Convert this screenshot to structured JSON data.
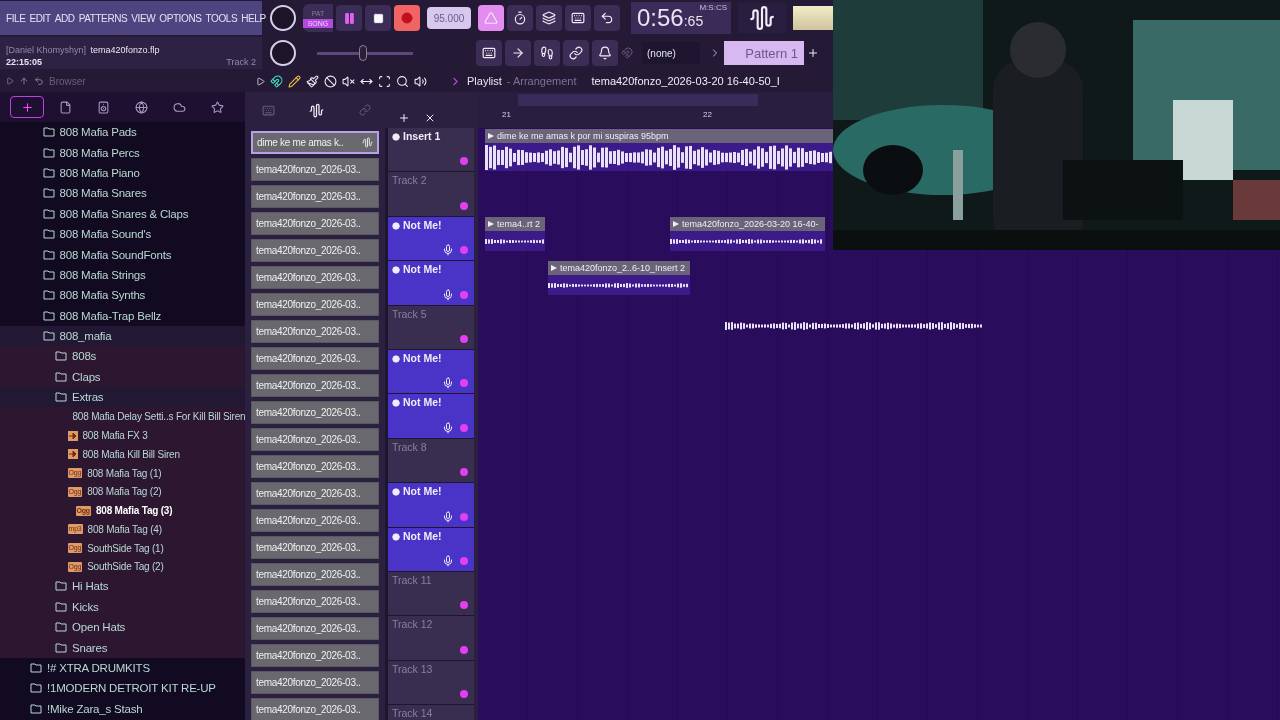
{
  "menu": [
    "FILE",
    "EDIT",
    "ADD",
    "PATTERNS",
    "VIEW",
    "OPTIONS",
    "TOOLS",
    "HELP"
  ],
  "transport": {
    "modes": [
      {
        "label": "PAT",
        "selected": false
      },
      {
        "label": "SONG",
        "selected": true
      }
    ],
    "playing": true,
    "tempo": "95.000",
    "time": "0:56",
    "time_fraction": ":65",
    "time_format": "M:S:CS"
  },
  "project": {
    "user": "[Daniel Khomyshyn]",
    "file": "tema420fonzo.flp",
    "clock": "22:15:05",
    "hint": "Track 2"
  },
  "master_pitch": {
    "level": 0.48
  },
  "snap": "(none)",
  "pattern": "Pattern 1",
  "browser": {
    "title": "Browser",
    "tabs": [
      {
        "kind": "all",
        "selected": true
      },
      {
        "kind": "file",
        "selected": false
      },
      {
        "kind": "speaker",
        "selected": false
      },
      {
        "kind": "plugin",
        "selected": false
      },
      {
        "kind": "cloud",
        "selected": false
      },
      {
        "kind": "star",
        "selected": false
      }
    ],
    "branch": [
      {
        "kind": "folder",
        "label": "808 Mafia Pads",
        "expanded": false,
        "selected": false
      },
      {
        "kind": "folder",
        "label": "808 Mafia Percs",
        "expanded": false,
        "selected": false
      },
      {
        "kind": "folder",
        "label": "808 Mafia Piano",
        "expanded": false,
        "selected": false
      },
      {
        "kind": "folder",
        "label": "808 Mafia Snares",
        "expanded": false,
        "selected": false
      },
      {
        "kind": "folder",
        "label": "808 Mafia Snares & Claps",
        "expanded": false,
        "selected": false
      },
      {
        "kind": "folder",
        "label": "808 Mafia Sound's",
        "expanded": false,
        "selected": false
      },
      {
        "kind": "folder",
        "label": "808 Mafia SoundFonts",
        "expanded": false,
        "selected": false
      },
      {
        "kind": "folder",
        "label": "808 Mafia Strings",
        "expanded": false,
        "selected": false
      },
      {
        "kind": "folder",
        "label": "808 Mafia Synths",
        "expanded": false,
        "selected": false
      },
      {
        "kind": "folder",
        "label": "808 Mafia-Trap Bellz",
        "expanded": false,
        "selected": false
      },
      {
        "kind": "folder",
        "label": "808_mafia",
        "expanded": true,
        "selected": false,
        "children": [
          {
            "kind": "folder",
            "label": "808s",
            "expanded": false,
            "selected": false
          },
          {
            "kind": "folder",
            "label": "Claps",
            "expanded": false,
            "selected": false
          },
          {
            "kind": "folder",
            "label": "Extras",
            "expanded": true,
            "selected": false,
            "children": [
              {
                "kind": "preset",
                "label": "808 Mafia Delay Setti..s For Kill Bill Siren",
                "selected": false
              },
              {
                "kind": "audio",
                "label": "808 Mafia FX 3",
                "selected": false
              },
              {
                "kind": "audio",
                "label": "808 Mafia Kill Bill Siren",
                "selected": false
              },
              {
                "kind": "badge",
                "badge": "Ogg",
                "label": "808 Mafia Tag (1)",
                "selected": false
              },
              {
                "kind": "badge",
                "badge": "Ogg",
                "label": "808 Mafia Tag (2)",
                "selected": false
              },
              {
                "kind": "badge",
                "badge": "Ogg",
                "label": "808 Mafia Tag (3)",
                "selected": true
              },
              {
                "kind": "badge",
                "badge": "mp3",
                "label": "808 Mafia Tag (4)",
                "selected": false
              },
              {
                "kind": "badge",
                "badge": "Ogg",
                "label": "SouthSide Tag (1)",
                "selected": false
              },
              {
                "kind": "badge",
                "badge": "Ogg",
                "label": "SouthSide Tag (2)",
                "selected": false
              }
            ]
          },
          {
            "kind": "folder",
            "label": "Hi Hats",
            "expanded": false,
            "selected": false
          },
          {
            "kind": "folder",
            "label": "Kicks",
            "expanded": false,
            "selected": false
          },
          {
            "kind": "folder",
            "label": "Open Hats",
            "expanded": false,
            "selected": false
          },
          {
            "kind": "folder",
            "label": "Snares",
            "expanded": false,
            "selected": false
          }
        ]
      }
    ],
    "items": [
      {
        "kind": "folder",
        "label": "!# XTRA DRUMKITS",
        "expanded": false,
        "selected": false
      },
      {
        "kind": "folder",
        "label": "!1MODERN DETROIT KIT RE-UP",
        "expanded": false,
        "selected": false
      },
      {
        "kind": "folder",
        "label": "!Mike Zara_s Stash",
        "expanded": false,
        "selected": false
      }
    ]
  },
  "playlist": {
    "title": "Playlist",
    "view": "- Arrangement",
    "arrangement": "tema420fonzo_2026-03-20 16-40-50_I",
    "patterns": [
      {
        "label": "dime ke me amas k..",
        "selected": true
      },
      {
        "label": "tema420fonzo_2026-03..",
        "selected": false
      },
      {
        "label": "tema420fonzo_2026-03..",
        "selected": false
      },
      {
        "label": "tema420fonzo_2026-03..",
        "selected": false
      },
      {
        "label": "tema420fonzo_2026-03..",
        "selected": false
      },
      {
        "label": "tema420fonzo_2026-03..",
        "selected": false
      },
      {
        "label": "tema420fonzo_2026-03..",
        "selected": false
      },
      {
        "label": "tema420fonzo_2026-03..",
        "selected": false
      },
      {
        "label": "tema420fonzo_2026-03..",
        "selected": false
      },
      {
        "label": "tema420fonzo_2026-03..",
        "selected": false
      },
      {
        "label": "tema420fonzo_2026-03..",
        "selected": false
      },
      {
        "label": "tema420fonzo_2026-03..",
        "selected": false
      },
      {
        "label": "tema420fonzo_2026-03..",
        "selected": false
      },
      {
        "label": "tema420fonzo_2026-03..",
        "selected": false
      },
      {
        "label": "tema420fonzo_2026-03..",
        "selected": false
      },
      {
        "label": "tema420fonzo_2026-03..",
        "selected": false
      },
      {
        "label": "tema420fonzo_2026-03..",
        "selected": false
      },
      {
        "label": "tema420fonzo_2026-03..",
        "selected": false
      },
      {
        "label": "tema420fonzo_2026-03..",
        "selected": false
      },
      {
        "label": "tema420fonzo_2026-03..",
        "selected": false
      },
      {
        "label": "tema420fonzo_2026-03..",
        "selected": false
      },
      {
        "label": "tema420fonzo_2026-03..",
        "selected": false
      }
    ],
    "ruler": [
      "21",
      "22"
    ],
    "tracks": [
      {
        "kind": "insert",
        "name": "Insert 1"
      },
      {
        "kind": "empty",
        "name": "Track 2"
      },
      {
        "kind": "recording",
        "name": "Not Me!"
      },
      {
        "kind": "recording",
        "name": "Not Me!"
      },
      {
        "kind": "empty",
        "name": "Track 5"
      },
      {
        "kind": "recording",
        "name": "Not Me!"
      },
      {
        "kind": "recording",
        "name": "Not Me!"
      },
      {
        "kind": "empty",
        "name": "Track 8"
      },
      {
        "kind": "recording",
        "name": "Not Me!"
      },
      {
        "kind": "recording",
        "name": "Not Me!"
      },
      {
        "kind": "empty",
        "name": "Track 11"
      },
      {
        "kind": "empty",
        "name": "Track 12"
      },
      {
        "kind": "empty",
        "name": "Track 13"
      },
      {
        "kind": "empty",
        "name": "Track 14"
      }
    ],
    "clips": [
      {
        "kind": "titled",
        "title": "dime ke me amas k por mi suspiras 95bpm"
      },
      {
        "kind": "titled",
        "title": "tema4..rt 2"
      },
      {
        "kind": "titled",
        "title": "tema420fonzo_2026-03-20 16-40-"
      },
      {
        "kind": "titled",
        "title": "tema420fonzo_2..6-10_Insert 2"
      },
      {
        "kind": "bare"
      }
    ]
  },
  "webcam": {
    "kind": "picture"
  }
}
